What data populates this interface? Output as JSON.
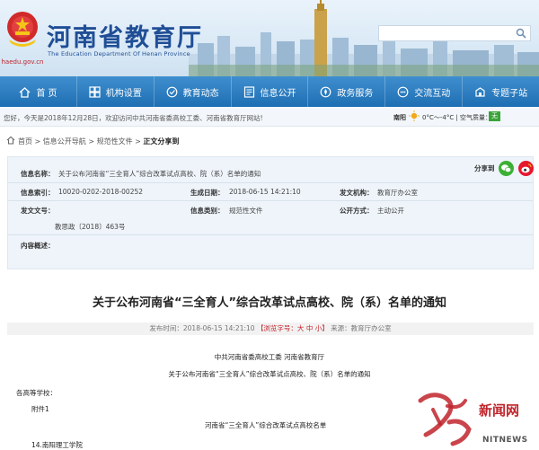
{
  "header": {
    "title": "河南省教育厅",
    "subtitle": "The Education Department Of Henan Province",
    "url": "haedu.gov.cn",
    "search_placeholder": ""
  },
  "nav": {
    "items": [
      {
        "label": "首 页",
        "icon": "home-icon"
      },
      {
        "label": "机构设置",
        "icon": "org-icon"
      },
      {
        "label": "教育动态",
        "icon": "news-icon"
      },
      {
        "label": "信息公开",
        "icon": "info-icon"
      },
      {
        "label": "政务服务",
        "icon": "service-icon"
      },
      {
        "label": "交流互动",
        "icon": "chat-icon"
      },
      {
        "label": "专题子站",
        "icon": "subsite-icon"
      }
    ]
  },
  "welcome": {
    "text": "您好，今天是2018年12月28日，欢迎访问中共河南省委高校工委、河南省教育厅网站!",
    "city": "南阳",
    "temp": "0°C～-4°C",
    "aq_label": "空气质量：",
    "aq_value": "无"
  },
  "breadcrumb": {
    "items": [
      "首页",
      "信息公开导航",
      "规范性文件"
    ],
    "current": "正文分享到"
  },
  "info": {
    "name_label": "信息名称：",
    "name_value": "关于公布河南省“三全育人”综合改革试点高校、院（系）名单的通知",
    "share_label": "分享到",
    "index_label": "信息索引：",
    "index_value": "10020-0202-2018-00252",
    "date_label": "生成日期：",
    "date_value": "2018-06-15 14:21:10",
    "org_label": "发文机构：",
    "org_value": "教育厅办公室",
    "docno_label": "发文文号：",
    "docno_value": "教思政〔2018〕463号",
    "category_label": "信息类别：",
    "category_value": "规范性文件",
    "mode_label": "公开方式：",
    "mode_value": "主动公开",
    "summary_label": "内容概述："
  },
  "article": {
    "title": "关于公布河南省“三全育人”综合改革试点高校、院（系）名单的通知",
    "meta_prefix": "发布时间：2018-06-15 14:21:10",
    "meta_red": "【浏览字号：大 中 小】",
    "meta_suffix": "来源：教育厅办公室",
    "issuer": "中共河南省委高校工委  河南省教育厅",
    "doc_title": "关于公布河南省“三全育人”综合改革试点高校、院（系）名单的通知",
    "salutation": "各高等学校：",
    "attachment": "附件1",
    "list_title": "河南省“三全育人”综合改革试点高校名单",
    "first_item": "14.南阳理工学院"
  },
  "watermark": {
    "cn": "新闻网",
    "en": "NITNEWS"
  },
  "colors": {
    "brand_blue": "#1f4e96",
    "nav_blue": "#1e6eb3",
    "accent_red": "#c0242b"
  }
}
